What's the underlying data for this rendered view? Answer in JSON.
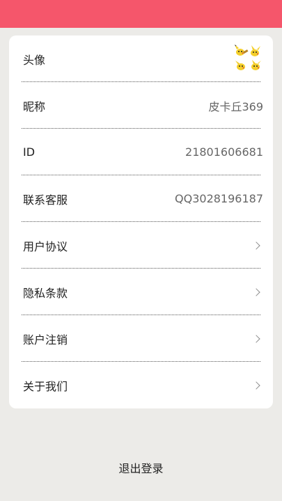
{
  "header": {
    "color": "#f5566b"
  },
  "profile": {
    "avatar_label": "头像",
    "avatar_icon": "pikachu-avatar",
    "nickname_label": "昵称",
    "nickname_value": "皮卡丘369",
    "id_label": "ID",
    "id_value": "21801606681",
    "support_label": "联系客服",
    "support_value": "QQ3028196187",
    "user_agreement_label": "用户协议",
    "privacy_label": "隐私条款",
    "delete_account_label": "账户注销",
    "about_label": "关于我们"
  },
  "footer": {
    "logout_label": "退出登录"
  }
}
